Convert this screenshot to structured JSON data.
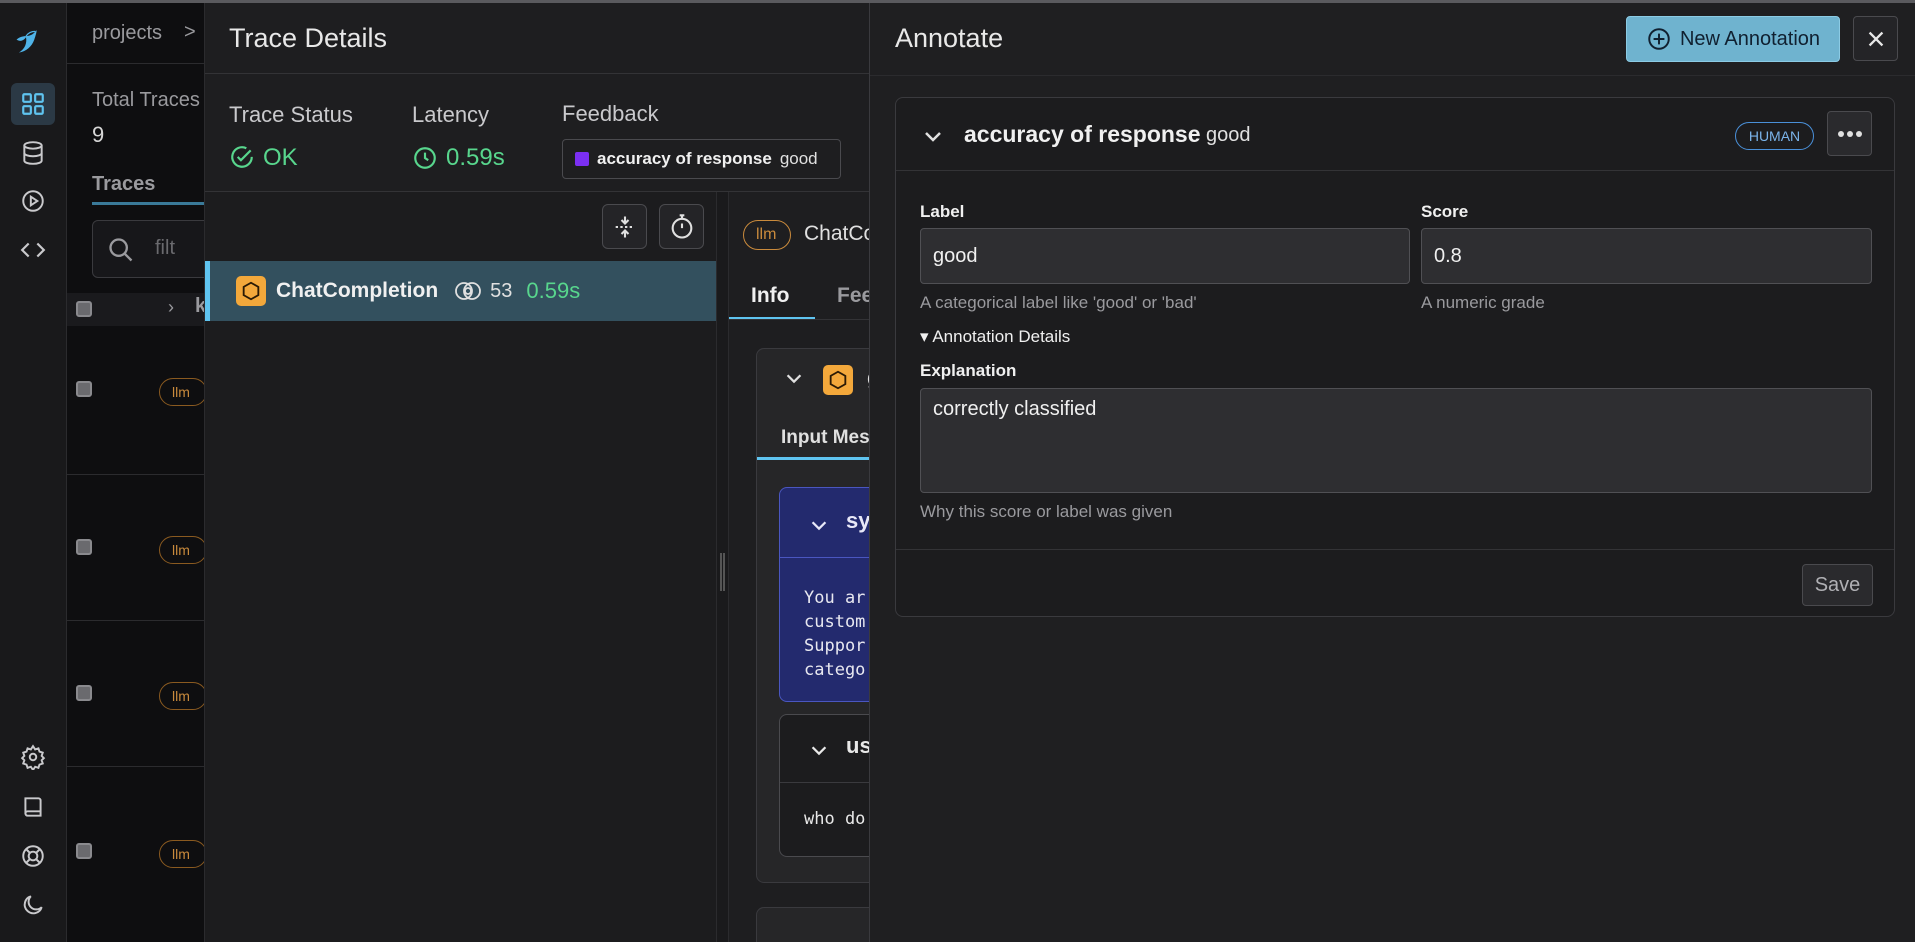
{
  "background": {
    "breadcrumb": "projects",
    "breadcrumb_sep": ">",
    "total_traces_label": "Total Traces",
    "total_traces_value": "9",
    "traces_tab": "Traces",
    "search_placeholder": "filt",
    "column_k": "k",
    "rows": [
      {
        "kind": "llm"
      },
      {
        "kind": "llm"
      },
      {
        "kind": "llm"
      },
      {
        "kind": "llm"
      }
    ]
  },
  "trace_details": {
    "title": "Trace Details",
    "status_label": "Trace Status",
    "status_value": "OK",
    "latency_label": "Latency",
    "latency_value": "0.59s",
    "feedback_label": "Feedback",
    "feedback_name": "accuracy of response",
    "feedback_value": "good",
    "span": {
      "name": "ChatCompletion",
      "tokens": "53",
      "latency": "0.59s"
    },
    "detail": {
      "kind_badge": "llm",
      "span_name": "ChatCo",
      "tab_info": "Info",
      "tab_feedback": "Fee",
      "card_title": "g",
      "input_messages_tab": "Input Mes",
      "system_role": "sy",
      "system_text": "You ar\ncustom\nSuppor\ncatego",
      "user_role": "us",
      "user_text": "who do"
    }
  },
  "annotate": {
    "title": "Annotate",
    "new_annotation_label": "New Annotation",
    "annotation": {
      "name": "accuracy of response",
      "value": "good",
      "source_badge": "HUMAN",
      "label_field_label": "Label",
      "label_value": "good",
      "label_help": "A categorical label like 'good' or 'bad'",
      "score_field_label": "Score",
      "score_value": "0.8",
      "score_help": "A numeric grade",
      "details_toggle": "▾ Annotation Details",
      "explanation_label": "Explanation",
      "explanation_value": "correctly classified",
      "explanation_help": "Why this score or label was given",
      "save_label": "Save"
    }
  },
  "colors": {
    "accent": "#6fb3cf",
    "ok_green": "#58d68d",
    "llm_orange": "#f3a83b",
    "feedback_purple": "#7b2ff2"
  }
}
